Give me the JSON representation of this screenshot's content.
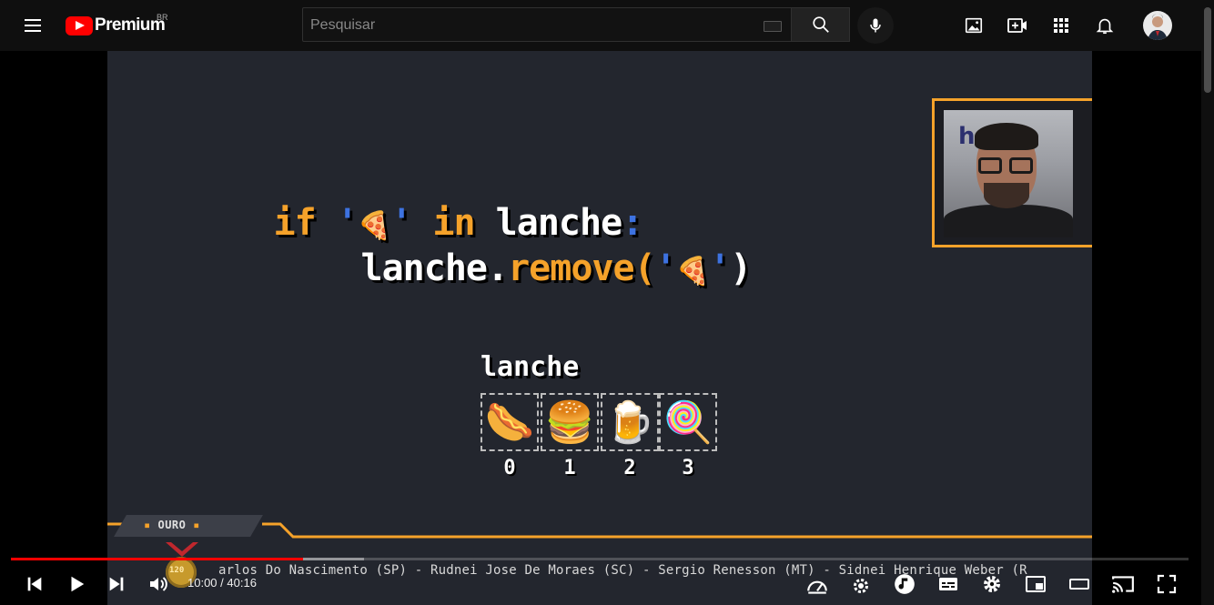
{
  "header": {
    "logo_text": "Premium",
    "region": "BR",
    "search_placeholder": "Pesquisar",
    "icons": [
      "menu-icon",
      "search-icon",
      "mic-icon",
      "image-icon",
      "create-icon",
      "apps-icon",
      "bell-icon",
      "avatar"
    ]
  },
  "video": {
    "code_line1": {
      "if": "if",
      "q1": "'",
      "q2": "'",
      "in": "in",
      "var": "lanche",
      "colon": ":"
    },
    "code_line2": {
      "obj": "lanche.",
      "method": "remove(",
      "q1": "'",
      "q2": "'",
      "close": ")"
    },
    "list_title": "lanche",
    "items": [
      {
        "emoji": "🌭",
        "index": "0"
      },
      {
        "emoji": "🍔",
        "index": "1"
      },
      {
        "emoji": "🍺",
        "index": "2"
      },
      {
        "emoji": "🍭",
        "index": "3"
      }
    ],
    "cam_logo": "h  et",
    "badge": {
      "label": "OURO",
      "medal": "120"
    },
    "ticker": "arlos Do Nascimento (SP) - Rudnei Jose De Moraes (SC) - Sergio Renesson (MT) - Sidnei Henrique Weber (R"
  },
  "player": {
    "current_time": "10:00",
    "separator": "/",
    "duration": "40:16",
    "played_fraction": 0.248,
    "buffered_fraction": 0.3,
    "colors": {
      "played": "#ff0000",
      "accent": "#f5a22a"
    }
  }
}
